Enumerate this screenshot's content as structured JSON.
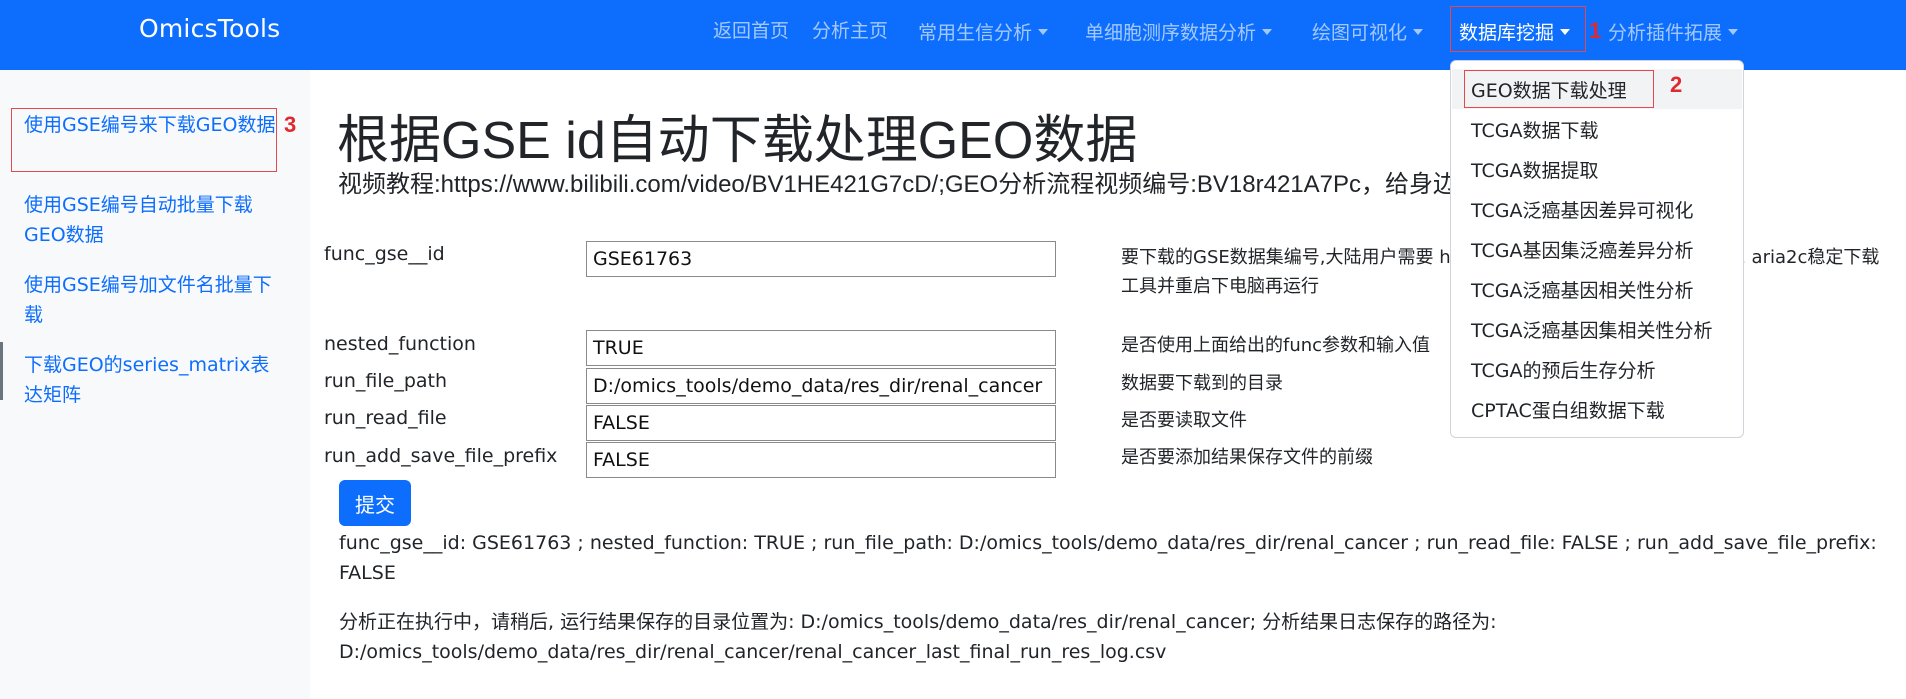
{
  "navbar": {
    "brand": "OmicsTools",
    "items": [
      {
        "label": "返回首页"
      },
      {
        "label": "分析主页"
      },
      {
        "label": "常用生信分析"
      },
      {
        "label": "单细胞测序数据分析"
      },
      {
        "label": "绘图可视化"
      },
      {
        "label": "数据库挖掘"
      },
      {
        "label": "分析插件拓展"
      }
    ]
  },
  "annotations": {
    "step1": "1",
    "step2": "2",
    "step3": "3"
  },
  "dropdown": {
    "items": [
      {
        "label": "GEO数据下载处理"
      },
      {
        "label": "TCGA数据下载"
      },
      {
        "label": "TCGA数据提取"
      },
      {
        "label": "TCGA泛癌基因差异可视化"
      },
      {
        "label": "TCGA基因集泛癌差异分析"
      },
      {
        "label": "TCGA泛癌基因相关性分析"
      },
      {
        "label": "TCGA泛癌基因集相关性分析"
      },
      {
        "label": "TCGA的预后生存分析"
      },
      {
        "label": "CPTAC蛋白组数据下载"
      }
    ]
  },
  "sidebar": {
    "items": [
      {
        "label": "使用GSE编号来下载GEO数据"
      },
      {
        "label": "使用GSE编号自动批量下载GEO数据"
      },
      {
        "label": "使用GSE编号加文件名批量下载"
      },
      {
        "label": "下载GEO的series_matrix表达矩阵"
      }
    ]
  },
  "main": {
    "title": "根据GSE id自动下载处理GEO数据",
    "subtitle": "视频教程:https://www.bilibili.com/video/BV1HE421G7cD/;GEO分析流程视频编号:BV18r421A7Pc，给身边的朋友，谢谢!",
    "params": [
      {
        "name": "func_gse__id",
        "value": "GSE61763",
        "desc": "要下载的GSE数据集编号,大陆用户需要 https://www.bilibili.com/video/BV1 aria2c稳定下载工具并重启下电脑再运行"
      },
      {
        "name": "nested_function",
        "value": "TRUE",
        "desc": "是否使用上面给出的func参数和输入值"
      },
      {
        "name": "run_file_path",
        "value": "D:/omics_tools/demo_data/res_dir/renal_cancer",
        "desc": "数据要下载到的目录"
      },
      {
        "name": "run_read_file",
        "value": "FALSE",
        "desc": "是否要读取文件"
      },
      {
        "name": "run_add_save_file_prefix",
        "value": "FALSE",
        "desc": "是否要添加结果保存文件的前缀"
      }
    ],
    "submit_label": "提交",
    "summary": "func_gse__id: GSE61763 ; nested_function: TRUE ; run_file_path: D:/omics_tools/demo_data/res_dir/renal_cancer ; run_read_file: FALSE ; run_add_save_file_prefix: FALSE",
    "status": "分析正在执行中，请稍后, 运行结果保存的目录位置为: D:/omics_tools/demo_data/res_dir/renal_cancer; 分析结果日志保存的路径为: D:/omics_tools/demo_data/res_dir/renal_cancer/renal_cancer_last_final_run_res_log.csv"
  },
  "colors": {
    "primary": "#0d6efd",
    "annotation": "#e0282e",
    "sidebar_bg": "#f8f9fa"
  }
}
